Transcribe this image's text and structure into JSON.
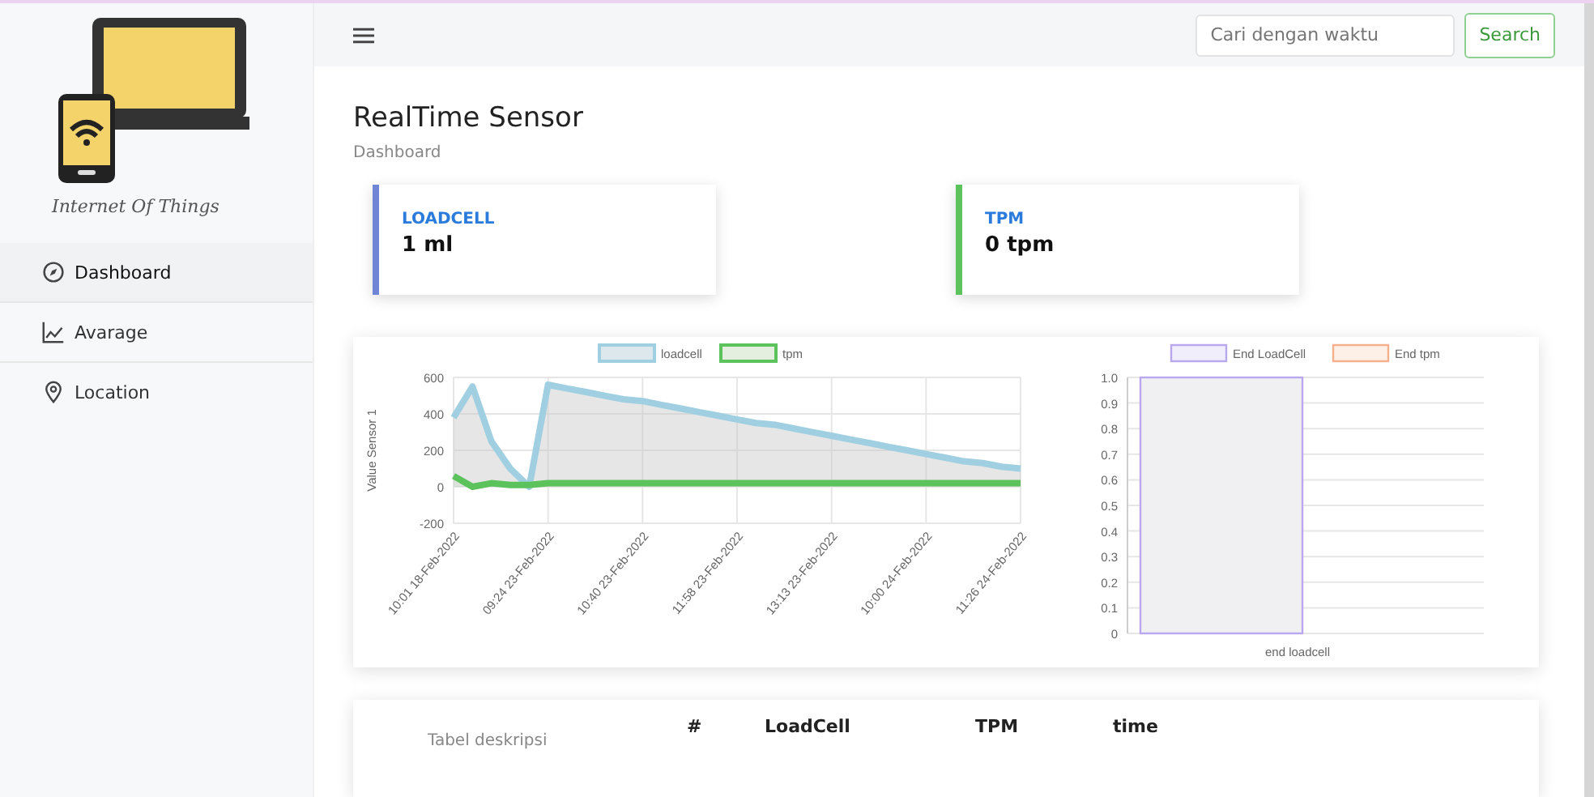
{
  "sidebar": {
    "logo_caption": "Internet Of Things",
    "items": [
      {
        "label": "Dashboard",
        "selected": true
      },
      {
        "label": "Avarage",
        "selected": false
      },
      {
        "label": "Location",
        "selected": false
      }
    ]
  },
  "topbar": {
    "search": {
      "placeholder": "Cari dengan waktu"
    },
    "search_button": "Search"
  },
  "page": {
    "title": "RealTime Sensor",
    "breadcrumb": "Dashboard"
  },
  "stats": [
    {
      "label": "LOADCELL",
      "value": "1 ml",
      "color": "#6f86d6"
    },
    {
      "label": "TPM",
      "value": "0 tpm",
      "color": "#5cc25c"
    }
  ],
  "line_chart": {
    "chart_data": {
      "type": "area",
      "grid": true,
      "legend": "top",
      "ylabel": "Value Sensor 1",
      "ylim": [
        -200,
        600
      ],
      "yticks": [
        -200,
        0,
        200,
        400,
        600
      ],
      "categories": [
        "10:01 18-Feb-2022",
        null,
        null,
        null,
        null,
        "09:24 23-Feb-2022",
        null,
        null,
        null,
        null,
        "10:40 23-Feb-2022",
        null,
        null,
        null,
        null,
        "11:58 23-Feb-2022",
        null,
        null,
        null,
        null,
        "13:13 23-Feb-2022",
        null,
        null,
        null,
        null,
        "10:00 24-Feb-2022",
        null,
        null,
        null,
        null,
        "11:26 24-Feb-2022"
      ],
      "series": [
        {
          "name": "loadcell",
          "color": "#9fcfe0",
          "values": [
            380,
            550,
            250,
            100,
            0,
            560,
            540,
            520,
            500,
            480,
            470,
            450,
            430,
            410,
            390,
            370,
            350,
            340,
            320,
            300,
            280,
            260,
            240,
            220,
            200,
            180,
            160,
            140,
            130,
            110,
            100
          ]
        },
        {
          "name": "tpm",
          "color": "#5cc25c",
          "values": [
            60,
            0,
            20,
            10,
            10,
            20,
            20,
            20,
            20,
            20,
            20,
            20,
            20,
            20,
            20,
            20,
            20,
            20,
            20,
            20,
            20,
            20,
            20,
            20,
            20,
            20,
            20,
            20,
            20,
            20,
            20
          ]
        }
      ]
    }
  },
  "bar_chart": {
    "chart_data": {
      "type": "bar",
      "grid": true,
      "legend": "top",
      "categories": [
        "end loadcell"
      ],
      "ylim": [
        0,
        1
      ],
      "yticks": [
        0,
        0.1,
        0.2,
        0.3,
        0.4,
        0.5,
        0.6,
        0.7,
        0.8,
        0.9,
        {
          "value": 1,
          "label": "1.0"
        }
      ],
      "series": [
        {
          "name": "End LoadCell",
          "color": "#b9a8f0",
          "values": [
            1
          ]
        },
        {
          "name": "End tpm",
          "color": "#f4b08a",
          "values": [
            0
          ]
        }
      ]
    }
  },
  "table": {
    "caption": "Tabel deskripsi",
    "columns": [
      "#",
      "LoadCell",
      "TPM",
      "time"
    ]
  }
}
